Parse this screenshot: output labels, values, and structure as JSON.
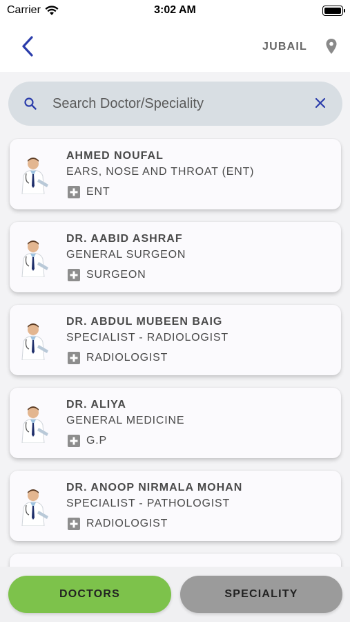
{
  "status_bar": {
    "carrier": "Carrier",
    "time": "3:02 AM"
  },
  "header": {
    "location": "JUBAIL"
  },
  "search": {
    "placeholder": "Search Doctor/Speciality",
    "value": ""
  },
  "doctors": [
    {
      "name": "AHMED NOUFAL",
      "department": "EARS, NOSE AND THROAT (ENT)",
      "speciality": "ENT"
    },
    {
      "name": "DR. AABID ASHRAF",
      "department": "GENERAL SURGEON",
      "speciality": "SURGEON"
    },
    {
      "name": "DR. ABDUL MUBEEN BAIG",
      "department": "SPECIALIST - RADIOLOGIST",
      "speciality": "RADIOLOGIST"
    },
    {
      "name": "DR. ALIYA",
      "department": "GENERAL MEDICINE",
      "speciality": "G.P"
    },
    {
      "name": "DR. ANOOP NIRMALA MOHAN",
      "department": "SPECIALIST - PATHOLOGIST",
      "speciality": "RADIOLOGIST"
    }
  ],
  "tabs": {
    "doctors": "DOCTORS",
    "speciality": "SPECIALITY"
  },
  "colors": {
    "accent_blue": "#2b3dab",
    "doctors_tab": "#7dc24b",
    "speciality_tab": "#9b9b9b",
    "search_bg": "#d8dee3"
  }
}
